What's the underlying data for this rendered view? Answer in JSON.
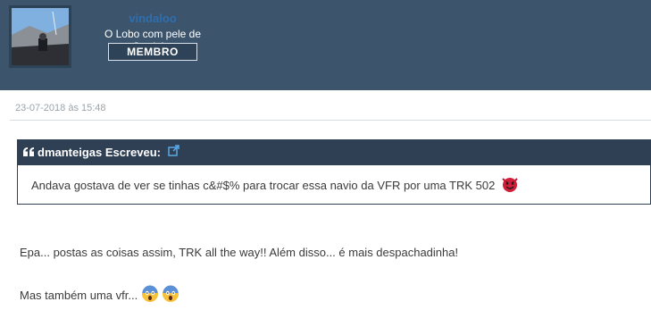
{
  "author": {
    "username": "vindaloo",
    "title": "O Lobo com pele de Cordeiro",
    "rank": "MEMBRO",
    "avatar_icon": "avatar-photo"
  },
  "post": {
    "date": "23-07-2018 às 15:48",
    "quote": {
      "author_label": "dmanteigas Escreveu:",
      "quote_icon": "quote-icon",
      "link_icon": "external-link-icon",
      "text": "Andava gostava de ver se tinhas c&#$% para trocar essa navio da VFR por uma TRK 502",
      "emoji": "devil-emoji"
    },
    "paragraphs": [
      "Epa... postas as coisas assim, TRK all the way!! Além disso... é mais despachadinha!",
      "Mas também uma vfr..."
    ],
    "trailing_emojis": [
      "scream-emoji",
      "scream-emoji"
    ]
  },
  "colors": {
    "header_bg": "#3c546c",
    "quote_header_bg": "#2f4055",
    "username": "#2e6fb0",
    "link_icon": "#5aa9e6"
  }
}
